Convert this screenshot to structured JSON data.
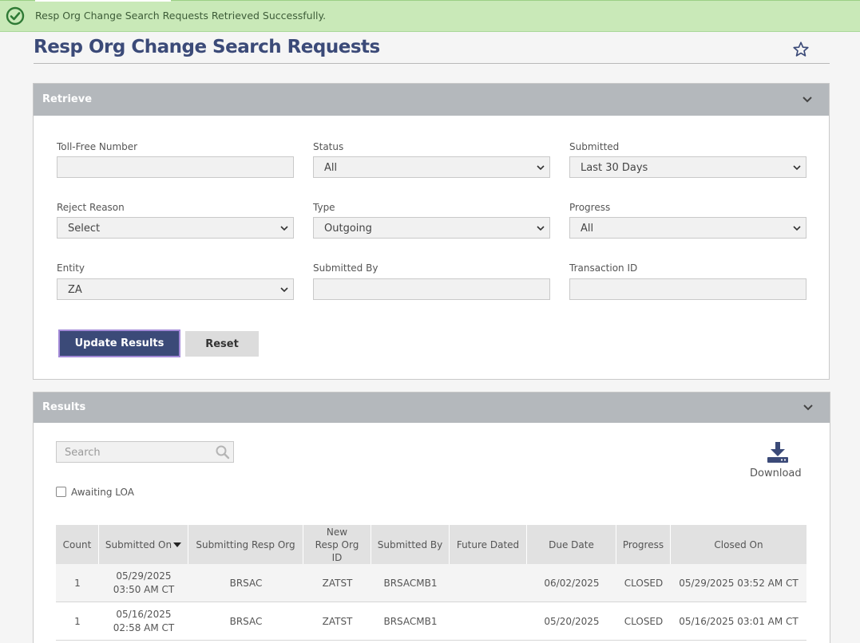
{
  "toast": {
    "message": "Resp Org Change Search Requests Retrieved Successfully.",
    "color": "#c9e9b8",
    "icon": "check-circle-icon"
  },
  "page": {
    "title": "Resp Org Change Search Requests",
    "favorite_icon": "star-icon"
  },
  "retrieve": {
    "title": "Retrieve",
    "fields": {
      "toll_free_number": {
        "label": "Toll-Free Number",
        "value": ""
      },
      "status": {
        "label": "Status",
        "value": "All"
      },
      "submitted": {
        "label": "Submitted",
        "value": "Last 30 Days"
      },
      "reject_reason": {
        "label": "Reject Reason",
        "value": "Select"
      },
      "type": {
        "label": "Type",
        "value": "Outgoing"
      },
      "progress": {
        "label": "Progress",
        "value": "All"
      },
      "entity": {
        "label": "Entity",
        "value": "ZA"
      },
      "submitted_by": {
        "label": "Submitted By",
        "value": ""
      },
      "transaction_id": {
        "label": "Transaction ID",
        "value": ""
      }
    },
    "update_label": "Update Results",
    "reset_label": "Reset"
  },
  "results": {
    "title": "Results",
    "search_placeholder": "Search",
    "download_label": "Download",
    "awaiting_loa_label": "Awaiting LOA",
    "columns": [
      "Count",
      "Submitted On",
      "Submitting Resp Org",
      "New Resp Org ID",
      "Submitted By",
      "Future Dated",
      "Due Date",
      "Progress",
      "Closed On"
    ],
    "rows": [
      {
        "count": "1",
        "submitted_on_date": "05/29/2025",
        "submitted_on_time": "03:50 AM CT",
        "submitting_resp_org": "BRSAC",
        "new_resp_org_id": "ZATST",
        "submitted_by": "BRSACMB1",
        "future_dated": "",
        "due_date": "06/02/2025",
        "progress": "CLOSED",
        "closed_on": "05/29/2025 03:52 AM CT"
      },
      {
        "count": "1",
        "submitted_on_date": "05/16/2025",
        "submitted_on_time": "02:58 AM CT",
        "submitting_resp_org": "BRSAC",
        "new_resp_org_id": "ZATST",
        "submitted_by": "BRSACMB1",
        "future_dated": "",
        "due_date": "05/20/2025",
        "progress": "CLOSED",
        "closed_on": "05/16/2025 03:01 AM CT"
      }
    ]
  },
  "colors": {
    "brand": "#3b4a78",
    "panel_header": "#b4b8bc",
    "focus_ring": "#a38ad8"
  }
}
